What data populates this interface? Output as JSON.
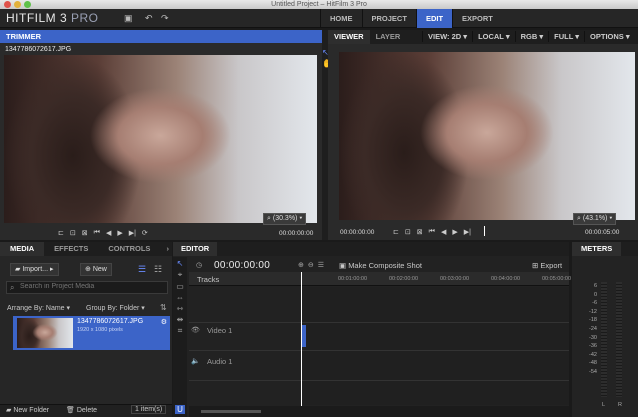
{
  "window": {
    "title": "Untitled Project – HitFilm 3 Pro"
  },
  "app": {
    "logo": "HITFILM 3",
    "logo_suffix": "PRO"
  },
  "nav": {
    "tabs": [
      "HOME",
      "PROJECT",
      "EDIT",
      "EXPORT"
    ],
    "active": "EDIT"
  },
  "trimmer": {
    "tab": "TRIMMER",
    "filename": "1347786072617.JPG",
    "zoom": "(30.3%)",
    "timecode": "00:00:00:00"
  },
  "viewer": {
    "tabs": [
      "VIEWER",
      "LAYER"
    ],
    "options": [
      "VIEW: 2D",
      "LOCAL",
      "RGB",
      "FULL",
      "OPTIONS"
    ],
    "zoom": "(43.1%)",
    "timecode_left": "00:00:00:00",
    "timecode_right": "00:00:05:00"
  },
  "media": {
    "tabs": [
      "MEDIA",
      "EFFECTS",
      "CONTROLS"
    ],
    "import_label": "Import...",
    "new_label": "New",
    "search_placeholder": "Search in Project Media",
    "arrange_label": "Arrange By: Name",
    "group_label": "Group By: Folder",
    "item": {
      "name": "1347786072617.JPG",
      "meta": "1920 x 1080 pixels"
    },
    "new_folder_label": "New Folder",
    "delete_label": "Delete",
    "count": "1 item(s)"
  },
  "editor": {
    "tab": "EDITOR",
    "timecode": "00:00:00:00",
    "make_composite": "Make Composite Shot",
    "export_label": "Export",
    "tracks_label": "Tracks",
    "ruler": [
      "00:01:00:00",
      "00:02:00:00",
      "00:03:00:00",
      "00:04:00:00",
      "00:05:00:00"
    ],
    "video_track": "Video 1",
    "audio_track": "Audio 1"
  },
  "meters": {
    "tab": "METERS",
    "scale": [
      "6",
      "0",
      "-6",
      "-12",
      "-18",
      "-24",
      "-30",
      "-36",
      "-42",
      "-48",
      "-54"
    ],
    "channels": [
      "L",
      "R"
    ]
  }
}
